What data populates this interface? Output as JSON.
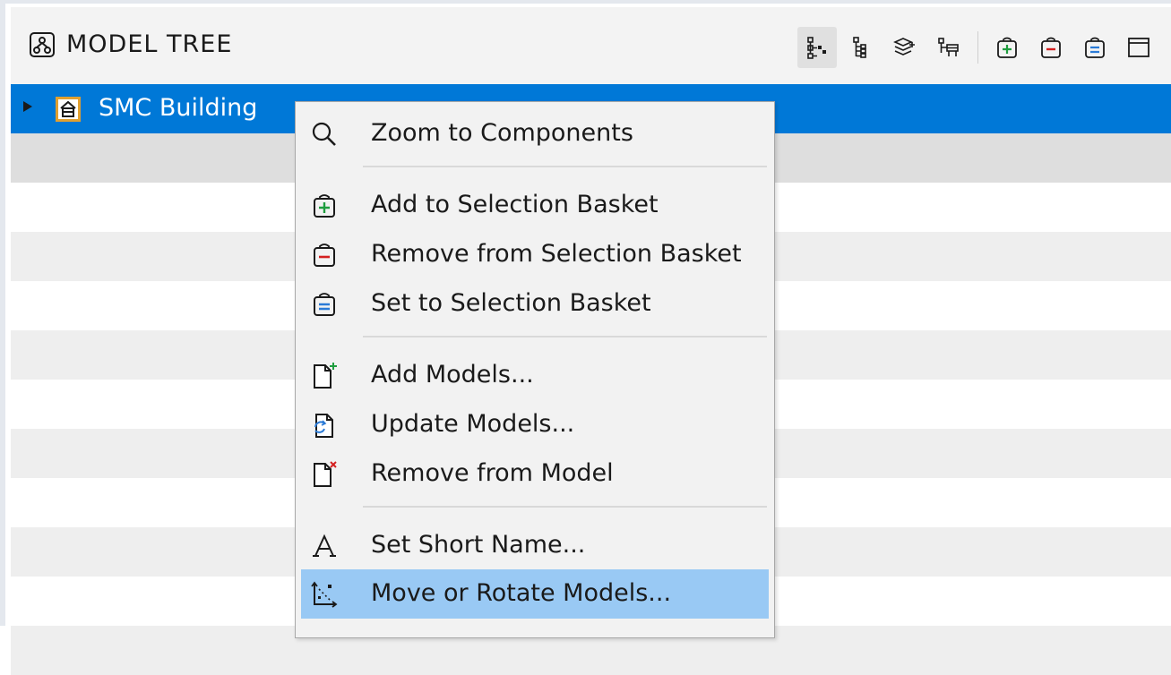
{
  "panel": {
    "title": "MODEL TREE",
    "title_icon": "model-tree-icon",
    "toolbar": [
      {
        "name": "tree-view-icon",
        "active": true
      },
      {
        "name": "flat-tree-icon",
        "active": false
      },
      {
        "name": "layers-icon",
        "active": false
      },
      {
        "name": "hierarchy-icon",
        "active": false
      },
      {
        "name": "basket-add-icon",
        "color": "#1f9d3f"
      },
      {
        "name": "basket-remove-icon",
        "color": "#d42020"
      },
      {
        "name": "basket-set-icon",
        "color": "#2a7ad6"
      },
      {
        "name": "window-icon"
      }
    ]
  },
  "tree": {
    "root": {
      "label": "SMC Building",
      "icon": "building-icon",
      "selected": true,
      "expanded": false
    }
  },
  "context_menu": {
    "items": [
      {
        "label": "Zoom to Components",
        "icon": "magnifier-icon"
      },
      {
        "label": "Add to Selection Basket",
        "icon": "basket-add-icon"
      },
      {
        "label": "Remove from Selection Basket",
        "icon": "basket-remove-icon"
      },
      {
        "label": "Set to Selection Basket",
        "icon": "basket-set-icon"
      },
      {
        "label": "Add Models...",
        "icon": "document-add-icon"
      },
      {
        "label": "Update Models...",
        "icon": "document-update-icon"
      },
      {
        "label": "Remove from Model",
        "icon": "document-remove-icon"
      },
      {
        "label": "Set Short Name...",
        "icon": "letter-a-icon"
      },
      {
        "label": "Move or Rotate Models...",
        "icon": "move-rotate-icon",
        "highlighted": true
      }
    ]
  },
  "colors": {
    "selection": "#0078d7",
    "menu_highlight": "#99c9f4",
    "add": "#1f9d3f",
    "remove": "#d42020",
    "set": "#2a7ad6",
    "building_icon": "#e0a030"
  }
}
